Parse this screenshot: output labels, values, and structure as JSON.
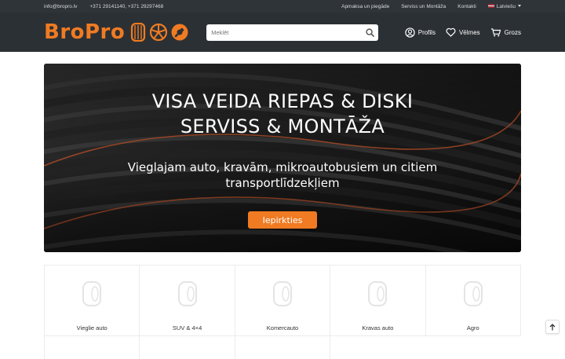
{
  "topbar": {
    "email": "info@bropro.lv",
    "phones": "+371 29141140, +371 29297468",
    "links": [
      "Apmaksa un piegāde",
      "Serviss un Montāža",
      "Kontakti"
    ],
    "language": "Latviešu"
  },
  "header": {
    "logo_text": "BroPro",
    "search_placeholder": "Meklēt",
    "nav": {
      "profile": "Profils",
      "wishlist": "Vēlmes",
      "cart": "Grozs"
    }
  },
  "hero": {
    "title_line1": "VISA VEIDA RIEPAS & DISKI",
    "title_line2": "SERVISS & MONTĀŽA",
    "subtitle": "Vieglajam auto, kravām, mikroautobusiem un citiem transportlīdzekļiem",
    "cta": "Iepirkties"
  },
  "categories": [
    {
      "label": "Vieglie auto"
    },
    {
      "label": "SUV & 4×4"
    },
    {
      "label": "Komercauto"
    },
    {
      "label": "Kravas auto"
    },
    {
      "label": "Agro"
    }
  ],
  "colors": {
    "accent": "#f07b22",
    "header_bg": "#2b3035",
    "topbar_bg": "#2f3439"
  },
  "icons": [
    "tire-icon",
    "rim-icon",
    "wrench-icon",
    "search-icon",
    "user-icon",
    "heart-icon",
    "cart-icon",
    "arrow-up-icon"
  ]
}
